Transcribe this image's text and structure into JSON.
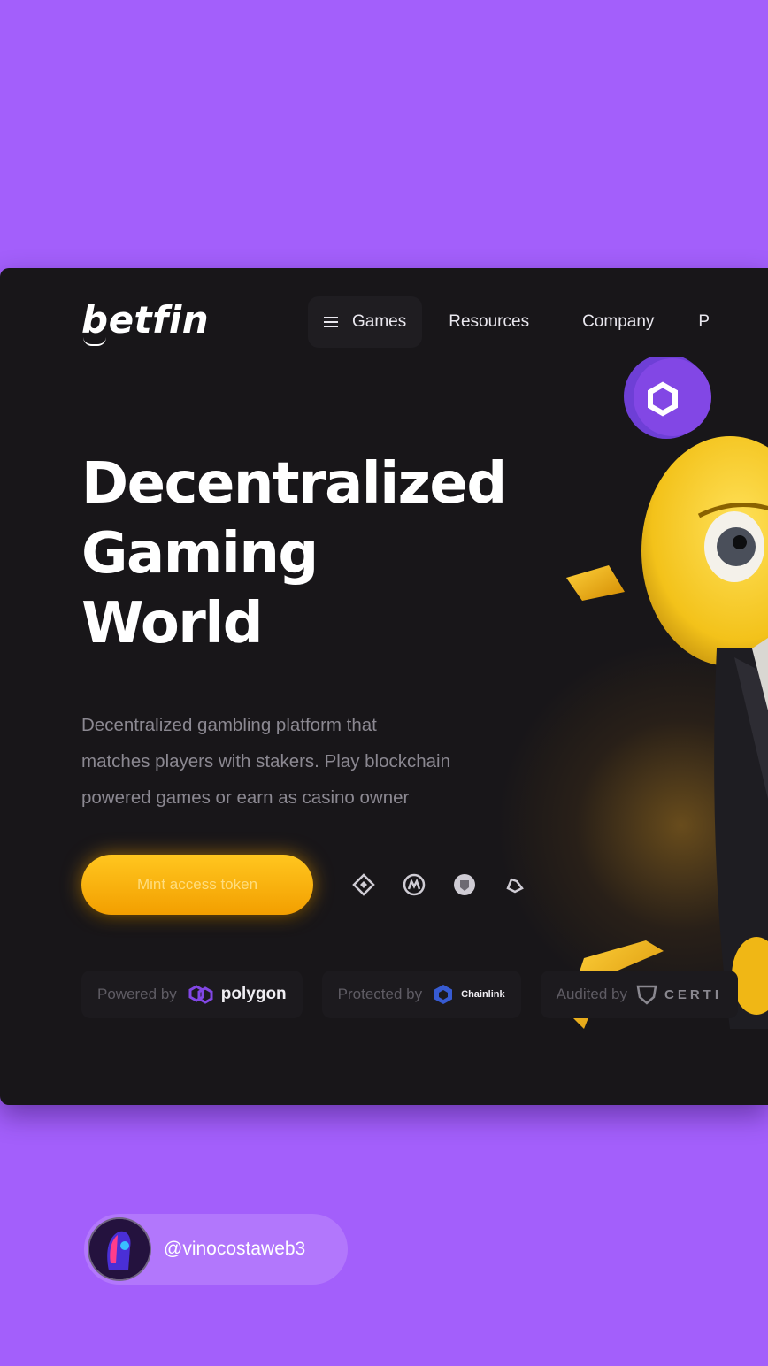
{
  "header": {
    "logo": "betfin",
    "nav": {
      "games": "Games",
      "resources": "Resources",
      "company": "Company",
      "partial": "P"
    }
  },
  "hero": {
    "title_lines": [
      "Decentralized",
      "Gaming",
      "World"
    ],
    "description_lines": [
      "Decentralized gambling platform that",
      "matches players with stakers. Play blockchain",
      "powered games or earn as casino owner"
    ],
    "cta": "Mint access token",
    "socials": [
      "binance-icon",
      "coinmarketcap-icon",
      "shield-icon",
      "recycle-icon"
    ]
  },
  "partners": [
    {
      "prefix": "Powered by",
      "brand": "polygon"
    },
    {
      "prefix": "Protected by",
      "brand": "Chainlink"
    },
    {
      "prefix": "Audited by",
      "brand": "CERTI"
    }
  ],
  "colors": {
    "background": "#a35ffb",
    "card": "#181619",
    "accent": "#ffb800",
    "polygon": "#8247e5",
    "chainlink": "#375bd2"
  },
  "footer": {
    "handle": "@vinocostaweb3"
  }
}
